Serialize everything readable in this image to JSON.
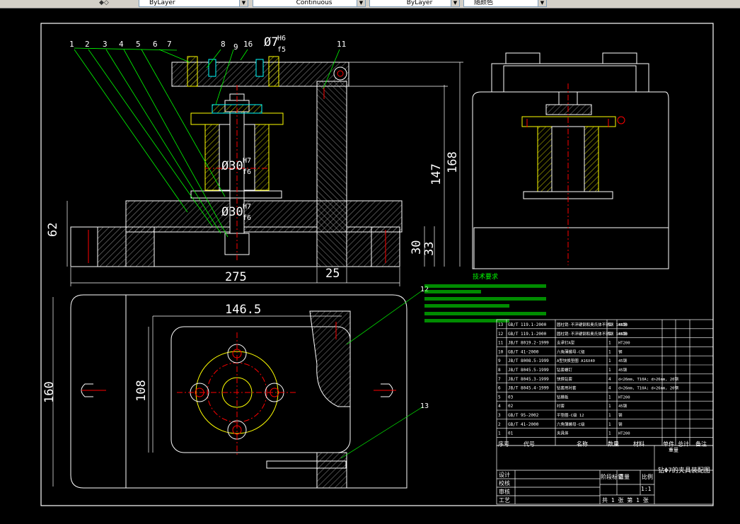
{
  "toolbar": {
    "layer_combo_1": "ByLayer",
    "linetype_combo": "Continuous",
    "lineweight_combo": "ByLayer",
    "color_combo": "随颜色"
  },
  "views": {
    "front_dims": {
      "d1": "Ø7",
      "d1_fit_top": "H6",
      "d1_fit_bot": "f5",
      "d2": "Ø30",
      "d2_fit_top": "H7",
      "d2_fit_bot": "f6",
      "d3": "Ø30",
      "d3_fit_top": "H7",
      "d3_fit_bot": "f6",
      "h62": "62",
      "w275": "275",
      "w25": "25",
      "h147": "147",
      "h168": "168",
      "h30": "30",
      "h33": "33"
    },
    "balloons_top": [
      "1",
      "2",
      "3",
      "4",
      "5",
      "6",
      "7",
      "8",
      "9",
      "16",
      "11"
    ],
    "plan_dims": {
      "w146": "146.5",
      "h108": "108",
      "h160": "160"
    },
    "balloon_12": "12",
    "balloon_13": "13"
  },
  "notes": {
    "title": "技术要求"
  },
  "bom": {
    "rows": [
      {
        "no": "13",
        "code": "GB/T 119.1-2000",
        "name": "圆柱销·不淬硬钢和奥氏体不锈钢 10X30",
        "qty": "1",
        "mat": "45钢"
      },
      {
        "no": "12",
        "code": "GB/T 119.1-2000",
        "name": "圆柱销·不淬硬钢和奥氏体不锈钢 10X30",
        "qty": "1",
        "mat": "45钢"
      },
      {
        "no": "11",
        "code": "JB/T 8019.2-1999",
        "name": "支承钉A型",
        "qty": "1",
        "mat": "HT200"
      },
      {
        "no": "10",
        "code": "GB/T 41-2000",
        "name": "六角薄螺母-C级",
        "qty": "1",
        "mat": "钢"
      },
      {
        "no": "9",
        "code": "JB/T 8008.5-1999",
        "name": "A型快换垫圈 A16X40",
        "qty": "1",
        "mat": "45钢"
      },
      {
        "no": "8",
        "code": "JB/T 8045.5-1999",
        "name": "钻套螺钉",
        "qty": "1",
        "mat": "45钢"
      },
      {
        "no": "7",
        "code": "JB/T 8045.3-1999",
        "name": "快换钻套",
        "qty": "4",
        "mat": "d<26mm, T10A; d>26mm, 20钢"
      },
      {
        "no": "6",
        "code": "JB/T 8045.4-1999",
        "name": "钻套用衬套",
        "qty": "4",
        "mat": "d<26mm, T10A; d>26mm, 20钢"
      },
      {
        "no": "5",
        "code": "03",
        "name": "钻模板",
        "qty": "1",
        "mat": "HT200"
      },
      {
        "no": "4",
        "code": "02",
        "name": "衬套",
        "qty": "1",
        "mat": "45钢"
      },
      {
        "no": "3",
        "code": "GB/T 95-2002",
        "name": "平垫圈-C级 12",
        "qty": "1",
        "mat": "钢"
      },
      {
        "no": "2",
        "code": "GB/T 41-2000",
        "name": "六角薄螺母-C级",
        "qty": "1",
        "mat": "钢"
      },
      {
        "no": "1",
        "code": "01",
        "name": "夹具体",
        "qty": "1",
        "mat": "HT200"
      }
    ],
    "header": {
      "no": "序号",
      "code": "代号",
      "name": "名称",
      "qty": "数量",
      "mat": "材料",
      "single": "单件",
      "total": "总计",
      "weight": "重量",
      "remark": "备注"
    }
  },
  "title_block": {
    "title": "钻Φ7的夹具装配图",
    "design": "设计",
    "check": "校核",
    "audit": "审核",
    "process": "工艺",
    "stage_mark": "阶段标记",
    "weight": "重量",
    "scale": "比例",
    "scale_value": "1:1",
    "sheets": "共 1 张  第 1 张"
  },
  "colors": {
    "yellow": "#ffff00",
    "cyan": "#00ffff",
    "green": "#00ff00",
    "red": "#ff0000",
    "white": "#ffffff",
    "magenta": "#ff00ff"
  }
}
